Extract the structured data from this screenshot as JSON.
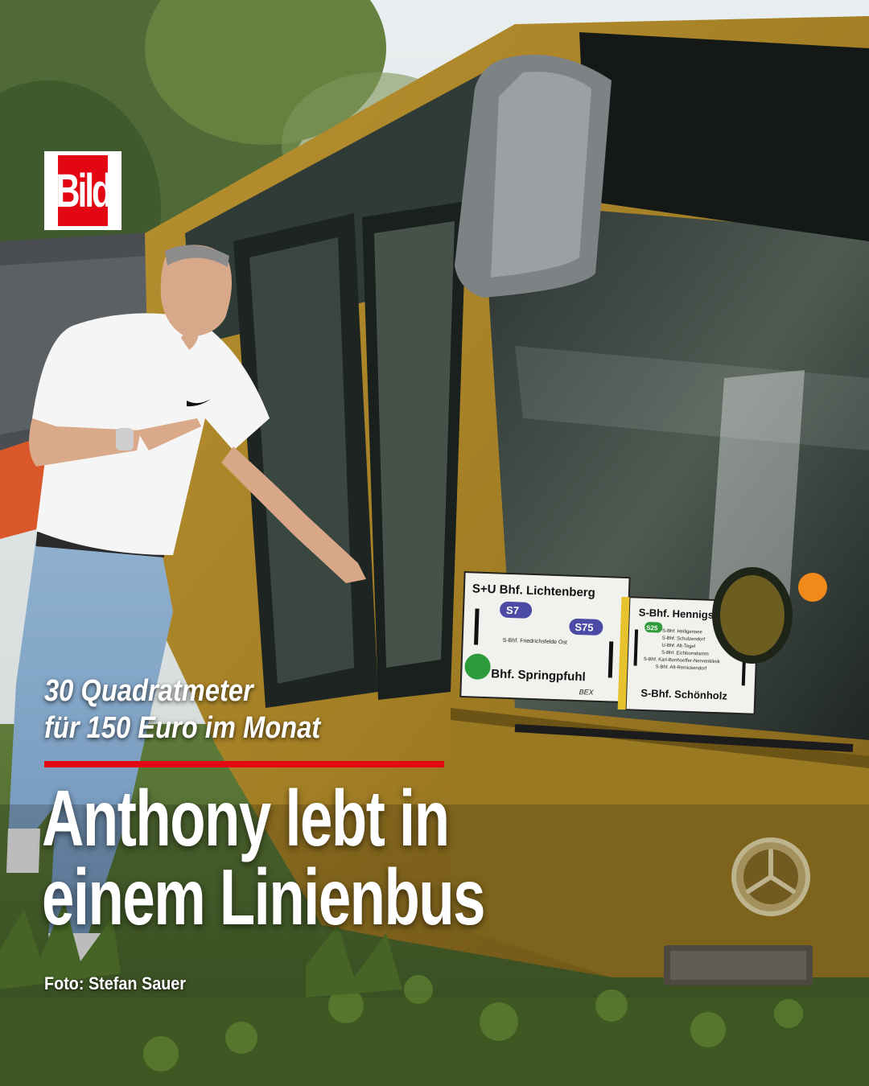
{
  "brand": {
    "logo_text": "Bild",
    "color": "#e30613"
  },
  "subline": [
    "30 Quadratmeter",
    "für 150 Euro im Monat"
  ],
  "headline": [
    "Anthony lebt in",
    "einem Linienbus"
  ],
  "credit": "Foto: Stefan Sauer",
  "photo": {
    "sign_left": {
      "line1": "S+U Bhf. Lichtenberg",
      "badge1": "S7",
      "badge2": "S75",
      "via": "S-Bhf. Friedrichsfelde Ost",
      "line2": "Bhf. Springpfuhl",
      "tag": "BEX"
    },
    "sign_right": {
      "line1": "S-Bhf. Hennigsdorf",
      "badge": "S25",
      "stops": [
        "S-Bhf. Heiligensee",
        "S-Bhf. Schulzendorf",
        "U-Bhf. Alt-Tegel",
        "S-Bhf. Eichborndamm",
        "S-Bhf. Karl-Bonhoeffer-Nervenklinik",
        "S-Bhf. Alt-Reinickendorf"
      ],
      "line2": "S-Bhf. Schönholz"
    }
  }
}
